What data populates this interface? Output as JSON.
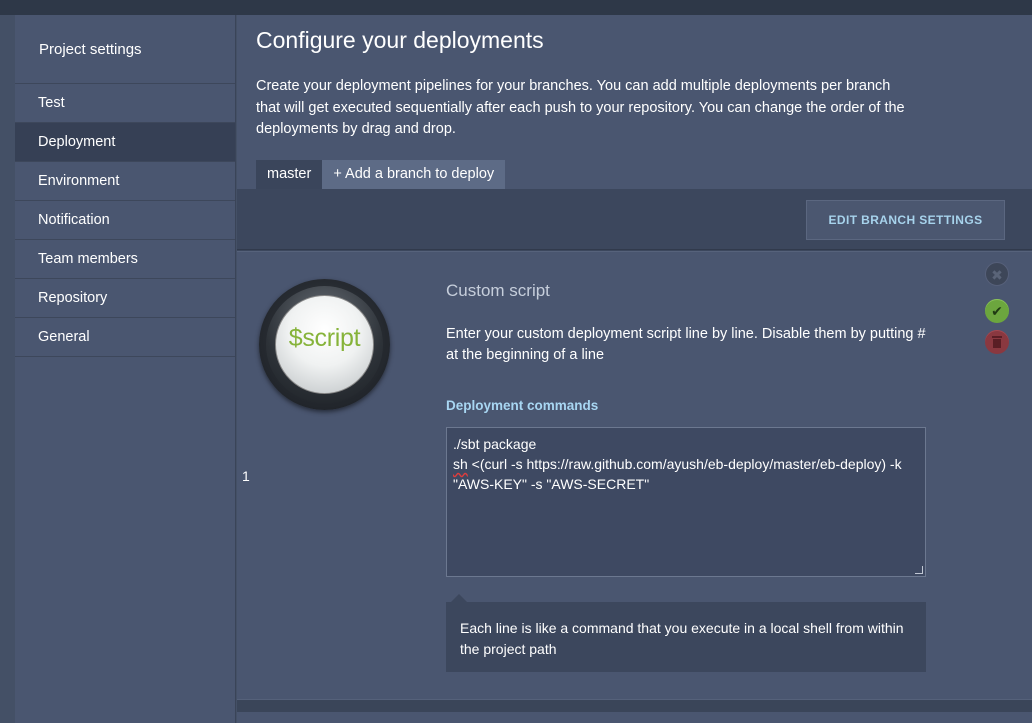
{
  "sidebar": {
    "title": "Project settings",
    "items": [
      {
        "label": "Test"
      },
      {
        "label": "Deployment"
      },
      {
        "label": "Environment"
      },
      {
        "label": "Notification"
      },
      {
        "label": "Team members"
      },
      {
        "label": "Repository"
      },
      {
        "label": "General"
      }
    ],
    "active_index": 1
  },
  "main": {
    "title": "Configure your deployments",
    "intro": "Create your deployment pipelines for your branches. You can add multiple deployments per branch that will get executed sequentially after each push to your repository. You can change the order of the deployments by drag and drop.",
    "tabs": [
      {
        "label": "master"
      },
      {
        "label": "+ Add a branch to deploy"
      }
    ],
    "edit_branch_label": "EDIT BRANCH SETTINGS"
  },
  "deployment": {
    "step_number": "1",
    "logo_text": "$script",
    "title": "Custom script",
    "description": "Enter your custom deployment script line by line. Disable them by putting # at the beginning of a line",
    "commands_label": "Deployment commands",
    "commands_line1": "./sbt package",
    "commands_line2_flagged": "sh",
    "commands_line2_rest": " <(curl -s https://raw.github.com/ayush/eb-deploy/master/eb-deploy) -k \"AWS-KEY\" -s \"AWS-SECRET\"",
    "hint": "Each line is like a command that you execute in a local shell from within the project path"
  },
  "icons": {
    "close": "close-icon",
    "ok": "check-icon",
    "delete": "trash-icon"
  },
  "colors": {
    "accent": "#a8d6f2",
    "ok": "#6ca63e",
    "delete": "#8a3840",
    "logo_text": "#86b33a"
  }
}
